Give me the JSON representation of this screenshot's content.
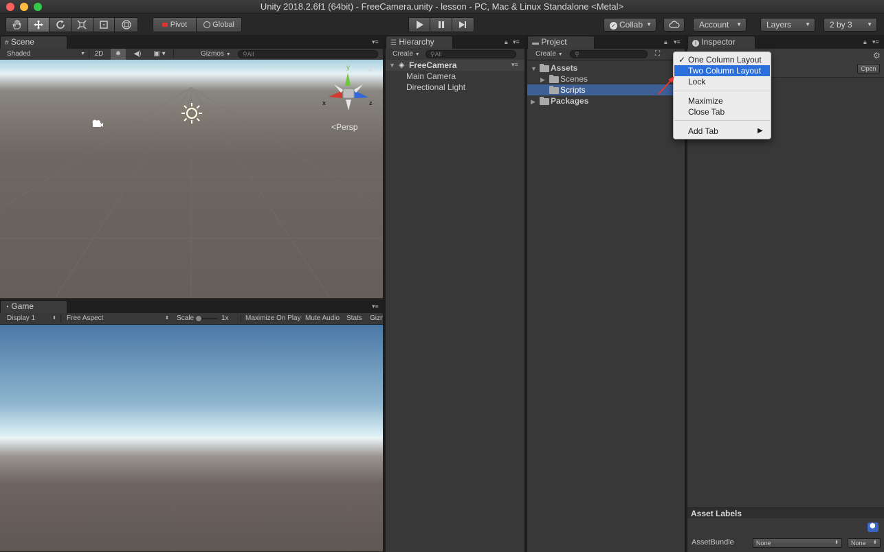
{
  "window": {
    "title": "Unity 2018.2.6f1 (64bit) - FreeCamera.unity - lesson - PC, Mac & Linux Standalone <Metal>"
  },
  "toolbar": {
    "pivot": "Pivot",
    "global": "Global",
    "collab": "Collab",
    "account": "Account",
    "layers": "Layers",
    "layout": "2 by 3"
  },
  "scene": {
    "tab": "Scene",
    "shading": "Shaded",
    "mode_2d": "2D",
    "gizmos": "Gizmos",
    "search_placeholder": "All",
    "gizmo_y": "y",
    "gizmo_x": "x",
    "gizmo_z": "z",
    "persp": "Persp"
  },
  "game": {
    "tab": "Game",
    "display": "Display 1",
    "aspect": "Free Aspect",
    "scale_label": "Scale",
    "scale_value": "1x",
    "maximize": "Maximize On Play",
    "mute": "Mute Audio",
    "stats": "Stats",
    "gizmos": "Gizn"
  },
  "hierarchy": {
    "tab": "Hierarchy",
    "create": "Create",
    "search_placeholder": "All",
    "scene_name": "FreeCamera",
    "items": [
      "Main Camera",
      "Directional Light"
    ]
  },
  "project": {
    "tab": "Project",
    "create": "Create",
    "assets": "Assets",
    "scenes": "Scenes",
    "scripts": "Scripts",
    "packages": "Packages"
  },
  "inspector": {
    "tab": "Inspector",
    "open": "Open",
    "asset_labels": "Asset Labels",
    "asset_bundle": "AssetBundle",
    "bundle_none": "None",
    "variant_none": "None"
  },
  "context_menu": {
    "items": [
      {
        "label": "One Column Layout",
        "checked": "✓"
      },
      {
        "label": "Two Column Layout"
      },
      {
        "label": "Lock"
      },
      {
        "label": "Maximize"
      },
      {
        "label": "Close Tab"
      },
      {
        "label": "Add Tab",
        "submenu": "▶"
      }
    ]
  },
  "colors": {
    "highlight": "#2a6fdb",
    "selection": "#3e5f96",
    "annotation_arrow": "#e8342e"
  }
}
